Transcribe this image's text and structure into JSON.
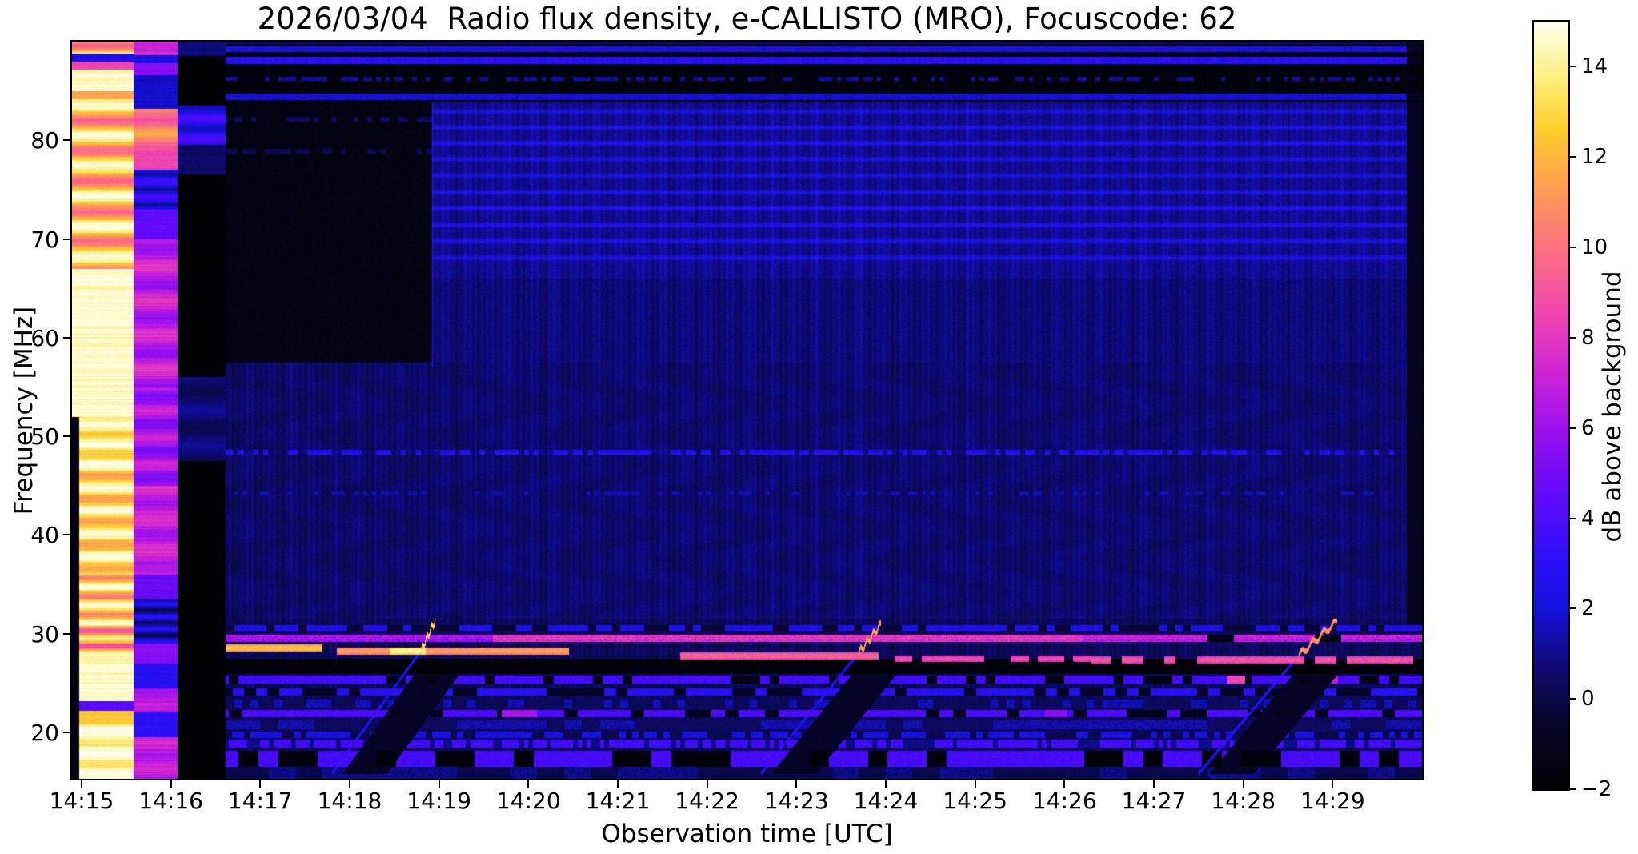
{
  "chart_data": {
    "type": "heatmap",
    "title": "2026/03/04  Radio flux density, e-CALLISTO (MRO), Focuscode: 62",
    "xlabel": "Observation time [UTC]",
    "ylabel": "Frequency [MHz]",
    "date": "2026/03/04",
    "instrument": "e-CALLISTO",
    "station": "MRO",
    "focuscode": "62",
    "x_axis": {
      "tick_labels": [
        "14:15",
        "14:16",
        "14:17",
        "14:18",
        "14:19",
        "14:20",
        "14:21",
        "14:22",
        "14:23",
        "14:24",
        "14:25",
        "14:26",
        "14:27",
        "14:28",
        "14:29"
      ],
      "tick_minutes": [
        0,
        1,
        2,
        3,
        4,
        5,
        6,
        7,
        8,
        9,
        10,
        11,
        12,
        13,
        14
      ],
      "range_minutes": [
        -0.107,
        15.0
      ]
    },
    "y_axis": {
      "tick_labels": [
        "20",
        "30",
        "40",
        "50",
        "60",
        "70",
        "80"
      ],
      "tick_values": [
        20,
        30,
        40,
        50,
        60,
        70,
        80
      ],
      "range_mhz": [
        15.3,
        90.0
      ]
    },
    "colorbar": {
      "label": "dB above background",
      "tick_labels": [
        "−2",
        "0",
        "2",
        "4",
        "6",
        "8",
        "10",
        "12",
        "14"
      ],
      "tick_values": [
        -2,
        0,
        2,
        4,
        6,
        8,
        10,
        12,
        14
      ],
      "range_db": [
        -2,
        15
      ]
    },
    "colormap_stops": [
      [
        0.0,
        0,
        0,
        0
      ],
      [
        0.09,
        8,
        6,
        45
      ],
      [
        0.16,
        15,
        10,
        115
      ],
      [
        0.235,
        20,
        18,
        220
      ],
      [
        0.3,
        45,
        15,
        248
      ],
      [
        0.38,
        95,
        10,
        250
      ],
      [
        0.46,
        150,
        15,
        240
      ],
      [
        0.54,
        205,
        35,
        215
      ],
      [
        0.62,
        240,
        70,
        175
      ],
      [
        0.7,
        252,
        110,
        130
      ],
      [
        0.78,
        255,
        155,
        85
      ],
      [
        0.86,
        255,
        205,
        45
      ],
      [
        0.93,
        255,
        240,
        130
      ],
      [
        1.0,
        255,
        255,
        238
      ]
    ],
    "heatmap_features": {
      "columns": [
        {
          "t": [
            -0.107,
            0.585
          ],
          "base": 14.6,
          "row_noise": 1.3,
          "bands": [
            [
              88.0,
              88.8,
              2.5
            ],
            [
              87.2,
              88.0,
              8.5
            ],
            [
              84.2,
              85.0,
              11.5
            ],
            [
              22.2,
              23.2,
              4.2
            ],
            [
              20.8,
              22.2,
              12.5
            ]
          ],
          "stripes": [
            [
              88.8,
              90.5,
              11.5,
              2.0,
              3.7
            ],
            [
              67,
              84.2,
              12.3,
              2.5,
              2.05
            ],
            [
              46.5,
              52,
              13.8,
              1.2,
              3.1
            ],
            [
              36,
              46.5,
              13.2,
              1.8,
              2.7
            ],
            [
              31,
              36,
              12.8,
              2.2,
              3.3
            ],
            [
              28,
              31,
              11.5,
              2.8,
              4.1
            ],
            [
              15,
              20.8,
              14.3,
              0.9,
              2.9
            ]
          ],
          "dark_intro": {
            "t_end": -0.03,
            "f_max": 52,
            "v": -1.3
          }
        },
        {
          "t": [
            0.585,
            1.075
          ],
          "base": 7.2,
          "row_noise": 1.0,
          "bands": [
            [
              87.8,
              88.6,
              2.2
            ],
            [
              86.6,
              87.8,
              5.5
            ],
            [
              83.2,
              86.6,
              1.8
            ],
            [
              77.0,
              79.0,
              8.5
            ],
            [
              70,
              73,
              4.5
            ],
            [
              33.5,
              36,
              4.8
            ],
            [
              27,
              29,
              5.5
            ],
            [
              24.5,
              27,
              2.8
            ],
            [
              19.5,
              22,
              3.0
            ]
          ],
          "stripes": [
            [
              79.0,
              83.2,
              10.3,
              1.2,
              2.2
            ],
            [
              73.0,
              77.0,
              2.6,
              1.3,
              4.0
            ],
            [
              55,
              70,
              6.8,
              1.1,
              1.8
            ],
            [
              45,
              55,
              6.2,
              1.0,
              2.3
            ],
            [
              36,
              45,
              7.0,
              0.8,
              2.0
            ],
            [
              29,
              33.5,
              1.5,
              1.5,
              5.0
            ],
            [
              22,
              24.5,
              6.5,
              0.5,
              2.0
            ],
            [
              15,
              19.5,
              6.8,
              0.6,
              2.4
            ]
          ]
        },
        {
          "t": [
            1.075,
            1.615
          ],
          "base": -1.9,
          "row_noise": 0.3,
          "bands": [
            [
              88.5,
              90.5,
              0.8
            ],
            [
              76.5,
              79.5,
              0.5
            ]
          ],
          "stripes": [
            [
              79.5,
              83.5,
              2.8,
              1.2,
              3.0
            ],
            [
              47.5,
              56,
              0.6,
              0.5,
              1.7
            ]
          ]
        }
      ],
      "top_zone": {
        "f_min": 83.8,
        "base": -1.55,
        "top_edge": {
          "f_min": 89.7,
          "v": 0.3
        },
        "lines": [
          [
            89.25,
            0.3,
            2.3,
            1
          ],
          [
            88.1,
            0.35,
            2.9,
            1
          ],
          [
            86.2,
            0.2,
            1.2,
            0.45
          ],
          [
            84.4,
            0.3,
            2.0,
            1
          ]
        ]
      },
      "dark_block": {
        "t": [
          1.615,
          3.925
        ],
        "f": [
          57.5,
          83.8
        ],
        "base": -1.35,
        "dotted_lines": [
          [
            82.1,
            0.25,
            0.4,
            0.45
          ],
          [
            78.9,
            0.25,
            0.2,
            0.4
          ]
        ]
      },
      "bright_block": {
        "t_start": 3.925,
        "f": [
          66,
          83.8
        ],
        "base": 1.05,
        "base_below": 0.75,
        "line_freqs": [
          82.9,
          81.3,
          79.7,
          78.1,
          76.4,
          74.7,
          73.1,
          71.4,
          69.8,
          68.1
        ],
        "line_amp": 1.7
      },
      "midband": {
        "f": [
          31.5,
          57.5
        ],
        "base": 0.6,
        "left_delta": -0.1
      },
      "boundary_line": {
        "t": 3.925,
        "f": [
          57,
          83.8
        ],
        "amp": 1.0
      },
      "right_edge": {
        "t_start": 14.83,
        "f_min": 30.9,
        "v": -0.85
      },
      "rfi_line_48": {
        "f": 48.4,
        "half_width": 0.24,
        "v": 2.7,
        "dash": [
          0.055,
          0.55
        ]
      },
      "rfi_line_44": {
        "f": 44.2,
        "half_width": 0.18,
        "v": 1.4,
        "dash": [
          0.05,
          0.3
        ]
      },
      "low_zone": {
        "f_max": 31.5,
        "base": 0.3,
        "band_3050": {
          "f": [
            30.22,
            30.88
          ],
          "v": 2.4,
          "off_v": -0.3,
          "dash": [
            0.09,
            0.62
          ]
        },
        "black_band": {
          "f": [
            25.9,
            27.5
          ],
          "v": -1.85
        },
        "line_295": {
          "f": 29.55,
          "half_width": 0.36,
          "v_early": 6.2,
          "v_mid": 8.0,
          "v_late": 7.0,
          "t_mid": 4.6,
          "t_late": 11.2
        },
        "bands": [
          {
            "f": [
              24.95,
              25.75
            ],
            "v": 3.6,
            "off_v": -1.2,
            "dash": [
              0.11,
              0.7
            ],
            "patches": [
              [
                12.92,
                0.1,
                8.5
              ],
              [
                14.0,
                0.06,
                7.0
              ]
            ]
          },
          {
            "f": [
              23.75,
              24.45
            ],
            "v": 2.8,
            "off_v": -0.8,
            "dash": [
              0.13,
              0.6
            ]
          },
          {
            "f": [
              22.55,
              23.35
            ],
            "v": 1.5,
            "off_v": 0.3,
            "dash": [
              0.09,
              0.3
            ]
          },
          {
            "f": [
              21.55,
              22.25
            ],
            "v": 3.9,
            "off_v": -1.0,
            "dash": [
              0.15,
              0.75
            ],
            "patches": [
              [
                4.9,
                0.2,
                6.2
              ],
              [
                10.9,
                0.12,
                5.6
              ]
            ]
          },
          {
            "f": [
              20.35,
              21.25
            ],
            "v": 1.4,
            "off_v": 0.4,
            "dash": [
              0.2,
              0.5
            ]
          },
          {
            "f": [
              19.45,
              20.05
            ],
            "v": 2.2,
            "off_v": 0.1,
            "dash": [
              0.07,
              0.5
            ]
          },
          {
            "f": [
              18.45,
              19.25
            ],
            "v": 3.6,
            "off_v": 1.0,
            "dash": [
              0.05,
              0.75
            ]
          },
          {
            "f": [
              16.55,
              18.15
            ],
            "v": 3.8,
            "off_v": -1.6,
            "dash": [
              0.22,
              0.6
            ]
          },
          {
            "f": [
              15.3,
              16.55
            ],
            "v": 0.9,
            "off_v": 0.1,
            "dash": [
              0.3,
              0.5
            ]
          }
        ],
        "segments_28": [
          {
            "t": [
              1.615,
              2.7
            ],
            "f": 28.55,
            "v": 12.8
          },
          {
            "t": [
              2.86,
              5.45
            ],
            "f": 28.25,
            "v": 11.8,
            "white": [
              3.45,
              3.85,
              14.5
            ]
          },
          {
            "t": [
              6.7,
              8.92
            ],
            "f": 27.75,
            "v": 10.0
          },
          {
            "t": [
              9.05,
              11.3
            ],
            "f": 27.45,
            "v": 9.0,
            "dash": [
              0.1,
              0.78
            ]
          },
          {
            "t": [
              11.3,
              14.9
            ],
            "f": 27.35,
            "v": 9.5,
            "dash": [
              0.12,
              0.8
            ]
          }
        ],
        "bursts": [
          {
            "t": [
              3.8,
              3.98
            ],
            "f": [
              28.3,
              31.8
            ],
            "v": 13.8
          },
          {
            "t": [
              8.7,
              8.95
            ],
            "f": [
              28.1,
              31.0
            ],
            "v": 12.5
          },
          {
            "t": [
              13.62,
              14.05
            ],
            "f": [
              27.8,
              31.3
            ],
            "v": 12.0
          }
        ],
        "sweeps": [
          {
            "t": [
              2.8,
              3.8
            ],
            "f": [
              15.8,
              28.3
            ],
            "v": 2.5
          },
          {
            "t": [
              7.6,
              8.7
            ],
            "f": [
              15.8,
              28.1
            ],
            "v": 2.4
          },
          {
            "t": [
              12.5,
              13.62
            ],
            "f": [
              15.8,
              27.8
            ],
            "v": 2.4
          }
        ],
        "sweep_shadow": {
          "dt": 0.12,
          "width": 0.5,
          "f_max": 27.2,
          "v": -0.7
        }
      }
    }
  }
}
